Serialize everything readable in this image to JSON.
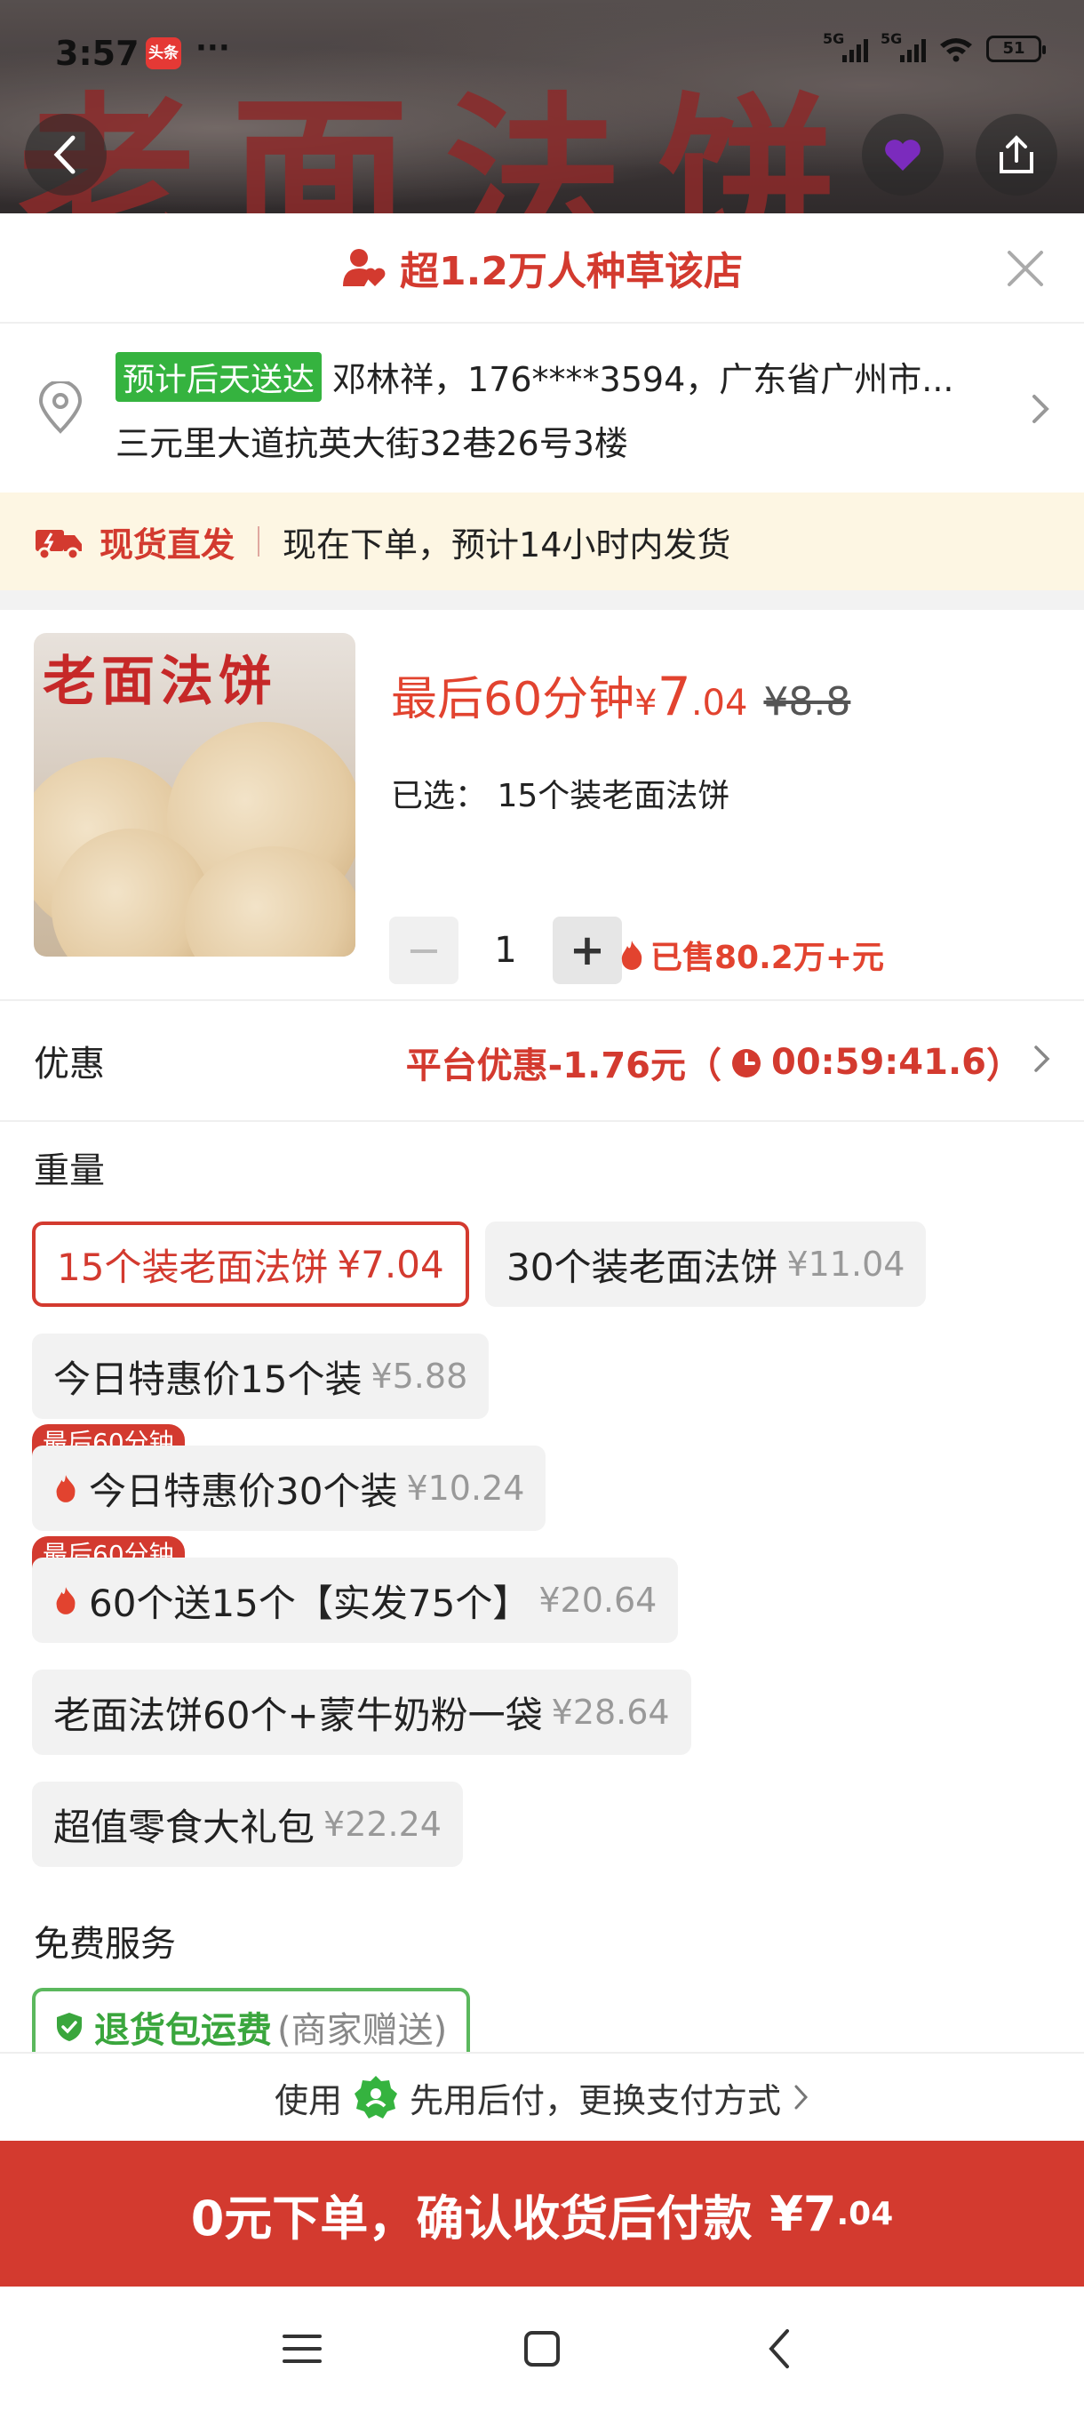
{
  "status_bar": {
    "time": "3:57",
    "app_badge": "头条",
    "dots": "···",
    "signal1": "5G",
    "signal2": "5G",
    "battery": "51"
  },
  "backdrop": {
    "banner_text": "老面法饼"
  },
  "fans_bar": {
    "text": "超1.2万人种草该店"
  },
  "address": {
    "eta_tag": "预计后天送达",
    "recipient": "邓林祥，176****3594，广东省广州市...",
    "detail": "三元里大道抗英大街32巷26号3楼"
  },
  "shipping": {
    "highlight": "现货直发",
    "desc": "现在下单，预计14小时内发货"
  },
  "product": {
    "thumb_title": "老面法饼",
    "promo": "最后60分钟",
    "currency": "¥",
    "price_int": "7",
    "price_dec": ".04",
    "original_price": "¥8.8",
    "selected_label": "已选：",
    "selected_value": "15个装老面法饼",
    "quantity": "1",
    "sold": "已售80.2万+元"
  },
  "discount": {
    "label": "优惠",
    "text": "平台优惠-1.76元（",
    "timer": "00:59:41.6",
    "close_paren": "）"
  },
  "weight": {
    "title": "重量",
    "options": [
      {
        "name": "15个装老面法饼",
        "price": "¥7.04",
        "selected": true
      },
      {
        "name": "30个装老面法饼",
        "price": "¥11.04"
      },
      {
        "name": "今日特惠价15个装",
        "price": "¥5.88"
      },
      {
        "name": "今日特惠价30个装",
        "price": "¥10.24",
        "tag": "最后60分钟"
      },
      {
        "name": "60个送15个【实发75个】",
        "price": "¥20.64",
        "tag": "最后60分钟"
      },
      {
        "name": "老面法饼60个+蒙牛奶粉一袋",
        "price": "¥28.64"
      },
      {
        "name": "超值零食大礼包",
        "price": "¥22.24"
      }
    ]
  },
  "free_service": {
    "title": "免费服务",
    "tag": "退货包运费",
    "note": "(商家赠送)"
  },
  "pay_bar": {
    "prefix": "使用",
    "text": "先用后付，更换支付方式"
  },
  "cta": {
    "main": "0元下单，确认收货后付款",
    "amount": "¥7",
    "decimal": ".04"
  },
  "colors": {
    "accent": "#d33a2f",
    "green": "#35b33f",
    "ship_bg": "#fdf6e3"
  }
}
